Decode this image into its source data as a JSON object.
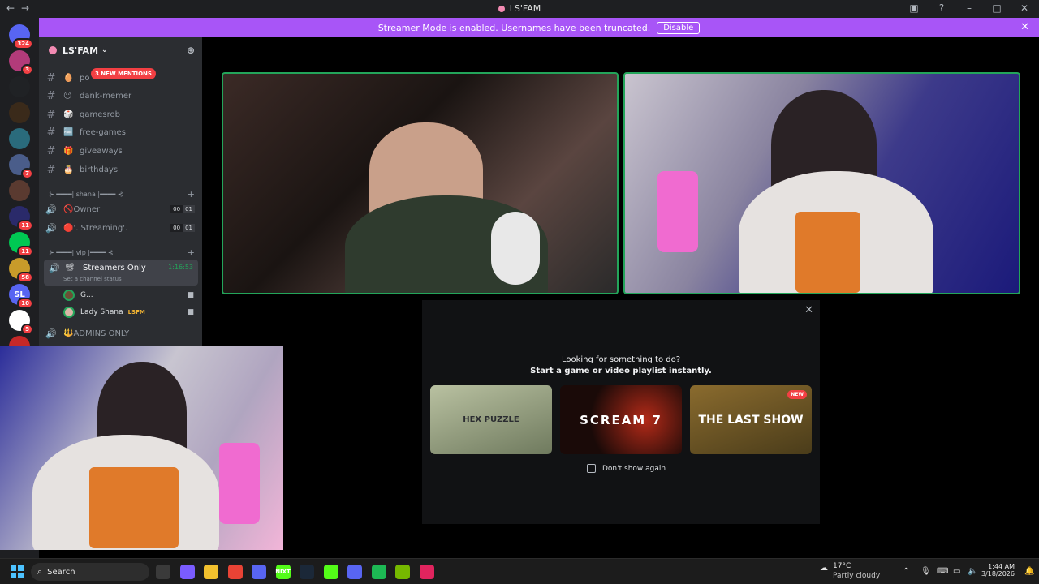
{
  "window": {
    "title": "LS'FAM"
  },
  "banner": {
    "text": "Streamer Mode is enabled. Usernames have been truncated.",
    "button": "Disable"
  },
  "rail": [
    {
      "color": "#5865f2",
      "label": "",
      "badge": "324"
    },
    {
      "color": "#b23b7a",
      "label": "",
      "badge": "3"
    },
    {
      "color": "#202225",
      "label": "",
      "badge": ""
    },
    {
      "color": "#3a2a1a",
      "label": "",
      "badge": ""
    },
    {
      "color": "#2a6b7c",
      "label": "",
      "badge": ""
    },
    {
      "color": "#4a5d8a",
      "label": "",
      "badge": "7"
    },
    {
      "color": "#5a3a30",
      "label": "",
      "badge": ""
    },
    {
      "color": "#2a2a6a",
      "label": "",
      "badge": "11"
    },
    {
      "color": "#00c853",
      "label": "",
      "badge": "11"
    },
    {
      "color": "#c89b2a",
      "label": "",
      "badge": "58"
    },
    {
      "color": "#5865f2",
      "label": "SL",
      "badge": "10"
    },
    {
      "color": "#ffffff",
      "label": "",
      "badge": "5"
    },
    {
      "color": "#c62828",
      "label": "",
      "badge": "20"
    }
  ],
  "guild": {
    "name": "LS'FAM"
  },
  "text_channels": [
    {
      "emoji": "🥚",
      "name": "po"
    },
    {
      "emoji": "😶",
      "name": "dank-memer"
    },
    {
      "emoji": "🎲",
      "name": "gamesrob"
    },
    {
      "emoji": "🆓",
      "name": "free-games"
    },
    {
      "emoji": "🎁",
      "name": "giveaways"
    },
    {
      "emoji": "🎂",
      "name": "birthdays"
    }
  ],
  "mentions": "3 NEW MENTIONS",
  "category1": {
    "label": "⊱ ━━━━| shana |━━━━ ⊰"
  },
  "voice1": [
    {
      "emoji": "🚫",
      "name": "Owner",
      "c1": "00",
      "c2": "01"
    },
    {
      "emoji": "🔴",
      "name": "'. Streaming'.",
      "c1": "00",
      "c2": "01"
    }
  ],
  "category2": {
    "label": "⊱ ━━━━| vip |━━━━ ⊰"
  },
  "active_voice": {
    "name": "Streamers Only",
    "time": "1:16:53",
    "status": "Set a channel status"
  },
  "users": [
    {
      "name": "G...",
      "tag": ""
    },
    {
      "name": "Lady Shana",
      "tag": "LSFM"
    }
  ],
  "admins": {
    "name": "ADMINS ONLY"
  },
  "activity": {
    "line1": "Looking for something to do?",
    "line2": "Start a game or video playlist instantly.",
    "cards": [
      {
        "title": "HEX PUZZLE",
        "badge": ""
      },
      {
        "title": "SCREAM 7",
        "badge": ""
      },
      {
        "title": "THE LAST SHOW",
        "badge": "NEW"
      }
    ],
    "checkbox": "Don't show again"
  },
  "taskbar": {
    "search": "Search",
    "weather_temp": "17°C",
    "weather_desc": "Partly cloudy",
    "time": "1:44 AM",
    "date": "3/18/2026",
    "apps": [
      {
        "color": "#3a3a3a",
        "label": ""
      },
      {
        "color": "#7a5cff",
        "label": ""
      },
      {
        "color": "#f2c12e",
        "label": ""
      },
      {
        "color": "#e94335",
        "label": ""
      },
      {
        "color": "#5865f2",
        "label": ""
      },
      {
        "color": "#53fc18",
        "label": "NIXT"
      },
      {
        "color": "#1b2838",
        "label": ""
      },
      {
        "color": "#53fc18",
        "label": ""
      },
      {
        "color": "#5865f2",
        "label": ""
      },
      {
        "color": "#1db954",
        "label": ""
      },
      {
        "color": "#76b900",
        "label": ""
      },
      {
        "color": "#e0245e",
        "label": ""
      }
    ]
  }
}
